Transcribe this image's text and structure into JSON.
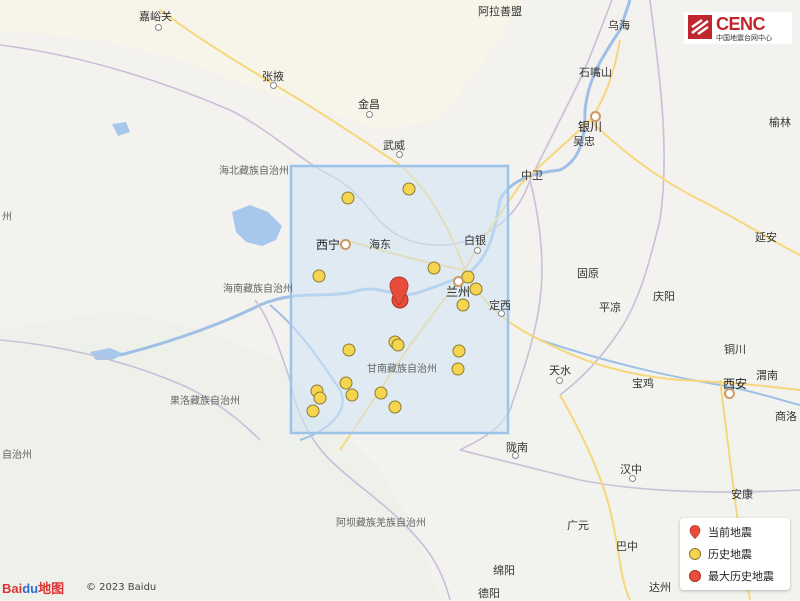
{
  "logo": {
    "title": "CENC",
    "subtitle": "中国地震台网中心",
    "icon": "cenc-logo-icon"
  },
  "legend": {
    "current": "当前地震",
    "history": "历史地震",
    "max_history": "最大历史地震"
  },
  "colors": {
    "history_fill": "#f5d54f",
    "current_fill": "#e84c3d",
    "max_fill": "#e84c3d",
    "box_fill": "#cfe3f5",
    "box_stroke": "#9cc3ea"
  },
  "footer": {
    "baidu_prefix": "Bai",
    "baidu_paw": "du",
    "baidu_suffix": "地图",
    "copyright": "© 2023 Baidu"
  },
  "cities": {
    "jiayuguan": "嘉峪关",
    "alashan": "阿拉善盟",
    "wuhai": "乌海",
    "zhangye": "张掖",
    "shizuishan": "石嘴山",
    "jinchang": "金昌",
    "yinchuan": "银川",
    "wuzhong": "吴忠",
    "yulin": "榆林",
    "wuwei": "武威",
    "zhongwei": "中卫",
    "haibei": "海北藏族自治州",
    "xining": "西宁",
    "haidong": "海东",
    "baiyin": "白银",
    "yanan": "延安",
    "hainan": "海南藏族自治州",
    "lanzhou": "兰州",
    "guyuan": "固原",
    "pingliang": "平凉",
    "qingyang": "庆阳",
    "dingxi": "定西",
    "tongchuan": "铜川",
    "gannan": "甘南藏族自治州",
    "tianshui": "天水",
    "weinan": "渭南",
    "baoji": "宝鸡",
    "xian": "西安",
    "guoluo": "果洛藏族自治州",
    "shangluo": "商洛",
    "longnan": "陇南",
    "hanzhong": "汉中",
    "ankang": "安康",
    "aba": "阿坝藏族羌族自治州",
    "guangyuan": "广元",
    "bazhong": "巴中",
    "mianyang": "绵阳",
    "dazhou": "达州",
    "deyang": "德阳",
    "left_cut": "州",
    "left_cut2": "自治州"
  }
}
